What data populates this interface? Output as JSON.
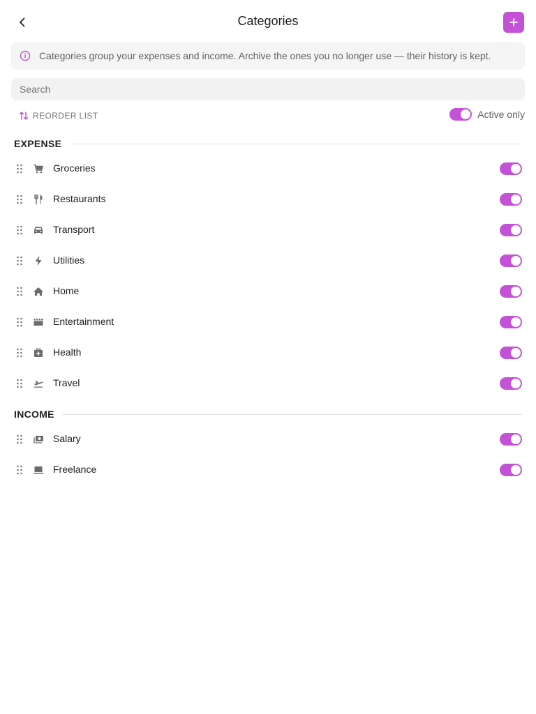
{
  "header": {
    "title": "Categories",
    "back_icon": "chevron-left-icon",
    "add_icon": "plus-icon"
  },
  "info": {
    "icon": "info-icon",
    "text": "Categories group your expenses and income. Archive the ones you no longer use — their history is kept."
  },
  "search": {
    "placeholder": "Search",
    "value": ""
  },
  "controls": {
    "reorder_label": "REORDER LIST",
    "active_only_label": "Active only",
    "active_only_on": true
  },
  "sections": {
    "expense": {
      "title": "EXPENSE",
      "items": [
        {
          "label": "Groceries",
          "icon": "cart-icon",
          "active": true
        },
        {
          "label": "Restaurants",
          "icon": "fork-knife-icon",
          "active": true
        },
        {
          "label": "Transport",
          "icon": "car-icon",
          "active": true
        },
        {
          "label": "Utilities",
          "icon": "bolt-icon",
          "active": true
        },
        {
          "label": "Home",
          "icon": "house-icon",
          "active": true
        },
        {
          "label": "Entertainment",
          "icon": "clapperboard-icon",
          "active": true
        },
        {
          "label": "Health",
          "icon": "medical-bag-icon",
          "active": true
        },
        {
          "label": "Travel",
          "icon": "plane-icon",
          "active": true
        }
      ]
    },
    "income": {
      "title": "INCOME",
      "items": [
        {
          "label": "Salary",
          "icon": "banknotes-icon",
          "active": true
        },
        {
          "label": "Freelance",
          "icon": "laptop-icon",
          "active": true
        }
      ]
    }
  },
  "colors": {
    "accent": "#c452d6",
    "icon_gray": "#6b6b6b",
    "surface": "#f5f5f5"
  }
}
